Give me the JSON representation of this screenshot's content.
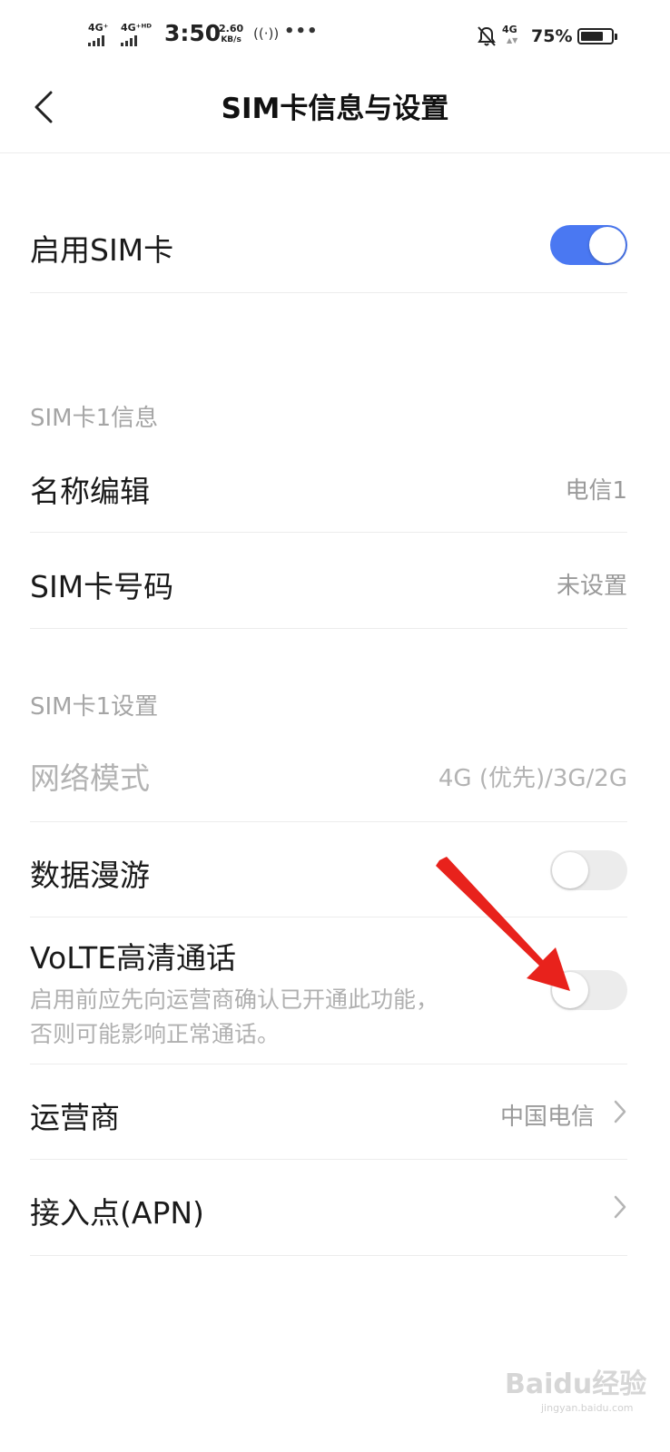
{
  "status_bar": {
    "sim1_net": "4G⁺",
    "sim2_net": "4G⁺ᴴᴰ",
    "time": "3:50",
    "speed_value": "2.60",
    "speed_unit": "KB/s",
    "net_right": "4G",
    "battery_pct": "75%",
    "battery_level": 0.75
  },
  "header": {
    "title": "SIM卡信息与设置"
  },
  "enable_sim": {
    "label": "启用SIM卡",
    "on": true
  },
  "info_section": {
    "title": "SIM卡1信息",
    "name_edit": {
      "label": "名称编辑",
      "value": "电信1"
    },
    "sim_number": {
      "label": "SIM卡号码",
      "value": "未设置"
    }
  },
  "settings_section": {
    "title": "SIM卡1设置",
    "network_mode": {
      "label": "网络模式",
      "value": "4G (优先)/3G/2G"
    },
    "data_roaming": {
      "label": "数据漫游",
      "on": false
    },
    "volte": {
      "label": "VoLTE高清通话",
      "desc_line1": "启用前应先向运营商确认已开通此功能，",
      "desc_line2": "否则可能影响正常通话。",
      "on": false
    },
    "carrier": {
      "label": "运营商",
      "value": "中国电信"
    },
    "apn": {
      "label": "接入点(APN)"
    }
  },
  "watermark": {
    "text": "Baidu经验",
    "sub": "jingyan.baidu.com"
  },
  "colors": {
    "accent": "#4a78f2",
    "annotation_arrow": "#e8221c"
  }
}
